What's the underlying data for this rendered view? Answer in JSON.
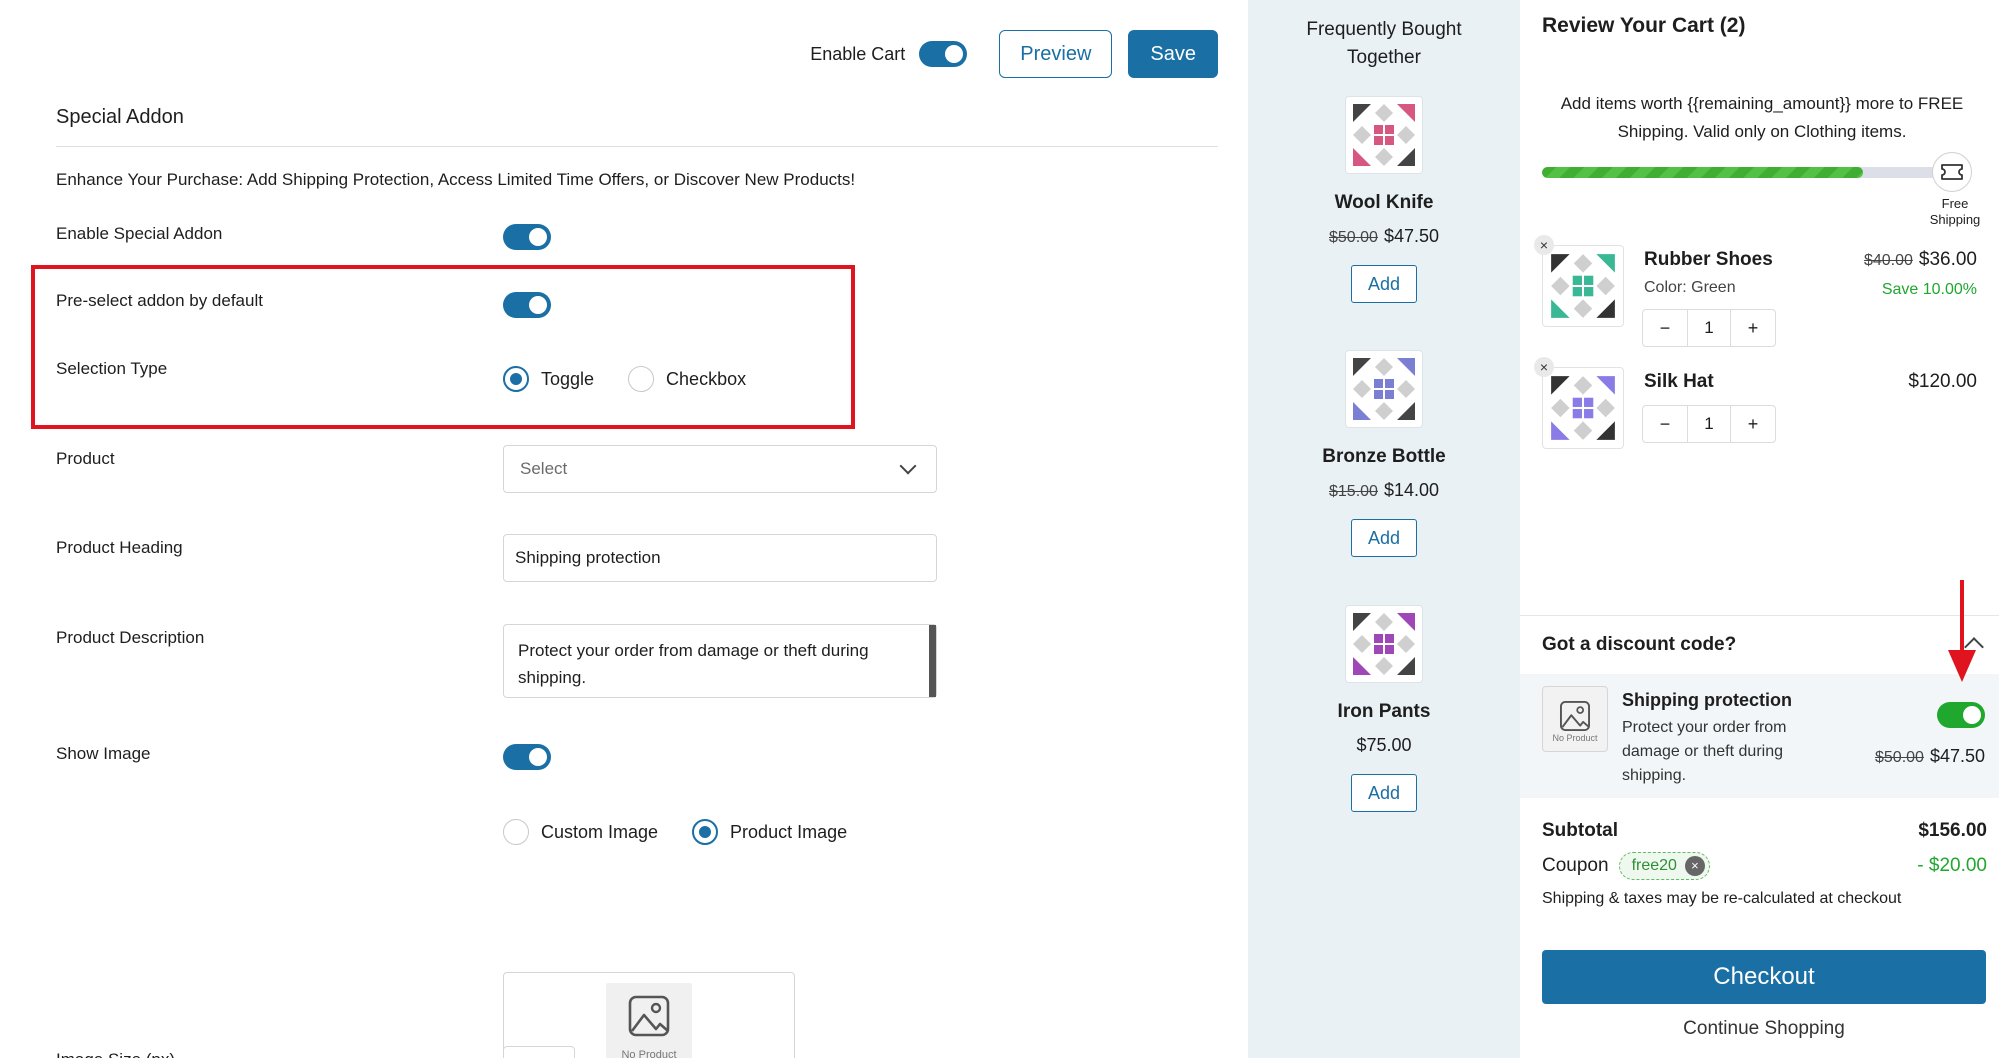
{
  "header": {
    "enable_cart_label": "Enable Cart",
    "preview_label": "Preview",
    "save_label": "Save"
  },
  "settings": {
    "section_title": "Special Addon",
    "intro": "Enhance Your Purchase: Add Shipping Protection, Access Limited Time Offers, or Discover New Products!",
    "enable_special_addon": "Enable Special Addon",
    "preselect_label": "Pre-select addon by default",
    "selection_type_label": "Selection Type",
    "selection_options": [
      "Toggle",
      "Checkbox"
    ],
    "product_label": "Product",
    "product_placeholder": "Select",
    "product_heading_label": "Product Heading",
    "product_heading_value": "Shipping protection",
    "product_description_label": "Product Description",
    "product_description_value": "Protect your order from damage or theft during shipping.",
    "show_image_label": "Show Image",
    "image_options": [
      "Custom Image",
      "Product Image"
    ],
    "no_product_caption": "No Product",
    "image_size_label": "Image Size (px)"
  },
  "fbt": {
    "title_line1": "Frequently Bought",
    "title_line2": "Together",
    "add_label": "Add",
    "items": [
      {
        "name": "Wool Knife",
        "old_price": "$50.00",
        "price": "$47.50",
        "color": "#d6577f"
      },
      {
        "name": "Bronze Bottle",
        "old_price": "$15.00",
        "price": "$14.00",
        "color": "#7b7fd4"
      },
      {
        "name": "Iron Pants",
        "old_price": "",
        "price": "$75.00",
        "color": "#a047b8"
      }
    ]
  },
  "cart": {
    "title": "Review Your Cart (2)",
    "shipping_msg": "Add items worth {{remaining_amount}} more to FREE Shipping. Valid only on Clothing items.",
    "progress": 0.78,
    "free_shipping_label_1": "Free",
    "free_shipping_label_2": "Shipping",
    "items": [
      {
        "name": "Rubber Shoes",
        "variant": "Color: Green",
        "old_price": "$40.00",
        "price": "$36.00",
        "save": "Save 10.00%",
        "qty": "1",
        "color": "#3ab795"
      },
      {
        "name": "Silk Hat",
        "variant": "",
        "old_price": "",
        "price": "$120.00",
        "save": "",
        "qty": "1",
        "color": "#8a7ce6"
      }
    ],
    "qty_minus": "−",
    "qty_plus": "+",
    "remove_symbol": "×",
    "discount_title": "Got a discount code?",
    "addon": {
      "title": "Shipping protection",
      "desc": "Protect your order from damage or theft during shipping.",
      "old_price": "$50.00",
      "price": "$47.50",
      "thumb_caption": "No Product"
    },
    "subtotal_label": "Subtotal",
    "subtotal_value": "$156.00",
    "coupon_label": "Coupon",
    "coupon_code": "free20",
    "coupon_value": "-  $20.00",
    "ship_note": "Shipping & taxes may be re-calculated at checkout",
    "checkout_label": "Checkout",
    "continue_label": "Continue Shopping"
  },
  "colors": {
    "accent": "#1a6fa4",
    "success": "#1fa72e",
    "highlight": "#e0141e"
  }
}
